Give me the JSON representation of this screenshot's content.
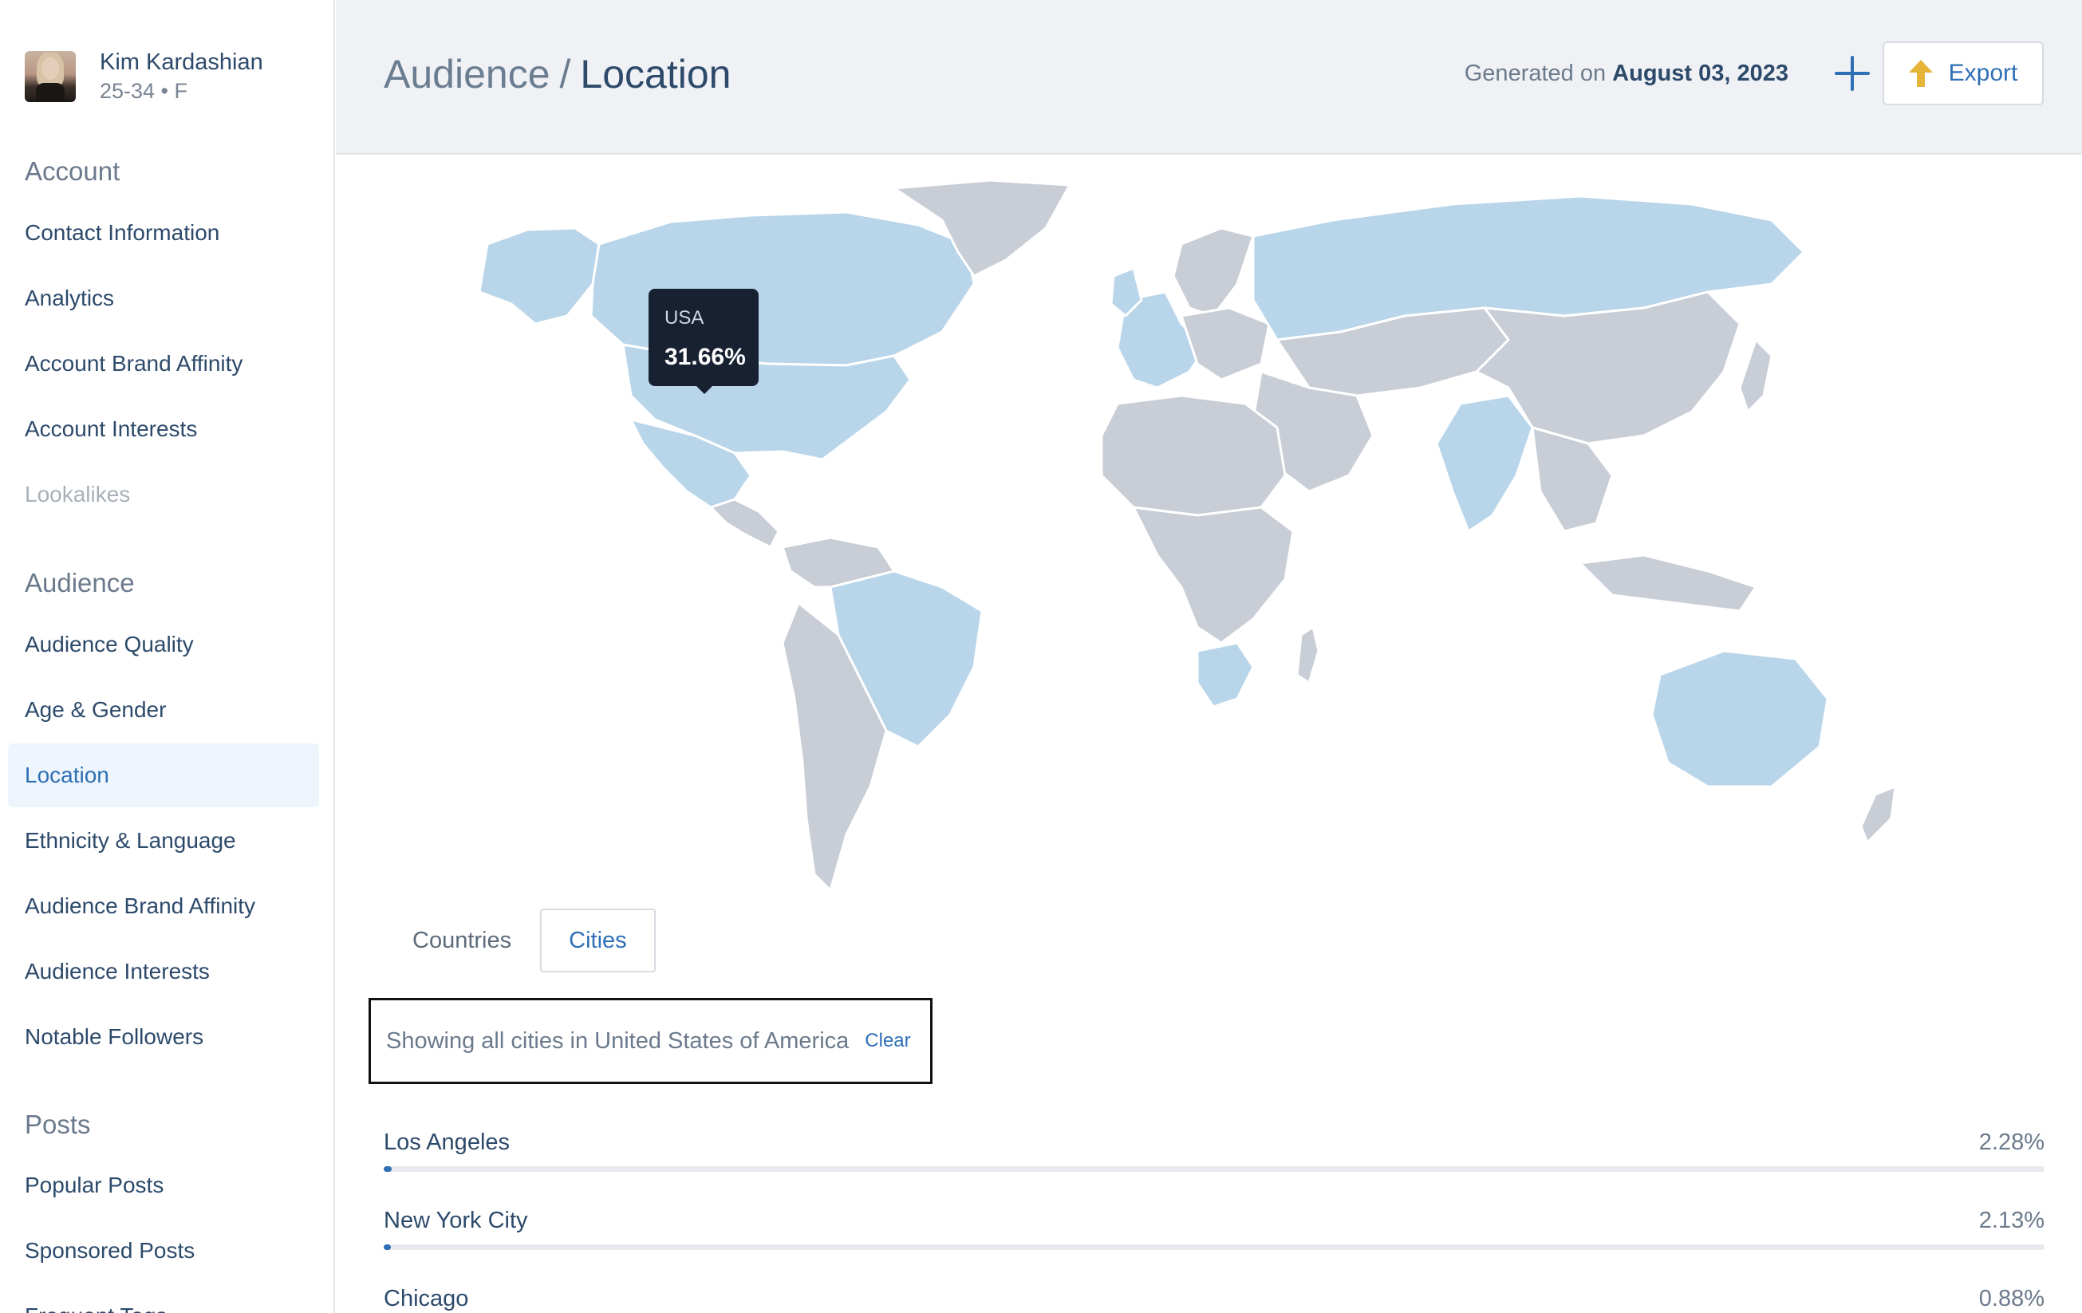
{
  "profile": {
    "name": "Kim Kardashian",
    "meta": "25-34 • F"
  },
  "sidebar": {
    "account_title": "Account",
    "account_items": [
      {
        "label": "Contact Information",
        "state": "normal"
      },
      {
        "label": "Analytics",
        "state": "normal"
      },
      {
        "label": "Account Brand Affinity",
        "state": "normal"
      },
      {
        "label": "Account Interests",
        "state": "normal"
      },
      {
        "label": "Lookalikes",
        "state": "disabled"
      }
    ],
    "audience_title": "Audience",
    "audience_items": [
      {
        "label": "Audience Quality",
        "state": "normal"
      },
      {
        "label": "Age & Gender",
        "state": "normal"
      },
      {
        "label": "Location",
        "state": "active"
      },
      {
        "label": "Ethnicity & Language",
        "state": "normal"
      },
      {
        "label": "Audience Brand Affinity",
        "state": "normal"
      },
      {
        "label": "Audience Interests",
        "state": "normal"
      },
      {
        "label": "Notable Followers",
        "state": "normal"
      }
    ],
    "posts_title": "Posts",
    "posts_items": [
      {
        "label": "Popular Posts",
        "state": "normal"
      },
      {
        "label": "Sponsored Posts",
        "state": "normal"
      },
      {
        "label": "Frequent Tags",
        "state": "normal"
      }
    ]
  },
  "header": {
    "crumb_parent": "Audience",
    "crumb_sep": "/",
    "crumb_current": "Location",
    "generated_prefix": "Generated on",
    "generated_date": "August 03, 2023",
    "export_label": "Export"
  },
  "map": {
    "highlight_color": "#b8d5ea",
    "base_color": "#c8cdd6",
    "tooltip": {
      "country": "USA",
      "value": "31.66%"
    }
  },
  "tabs": [
    {
      "label": "Countries",
      "active": false
    },
    {
      "label": "Cities",
      "active": true
    }
  ],
  "filter": {
    "text": "Showing all cities in United States of America",
    "clear_label": "Clear"
  },
  "cities": [
    {
      "name": "Los Angeles",
      "value": "2.28%",
      "fraction": 0.0228
    },
    {
      "name": "New York City",
      "value": "2.13%",
      "fraction": 0.0213
    },
    {
      "name": "Chicago",
      "value": "0.88%",
      "fraction": 0.0088
    }
  ],
  "colors": {
    "accent": "#2e6fb5",
    "export_icon": "#e5b53a"
  },
  "icons": {
    "plus": "plus-icon",
    "export": "export-icon"
  }
}
